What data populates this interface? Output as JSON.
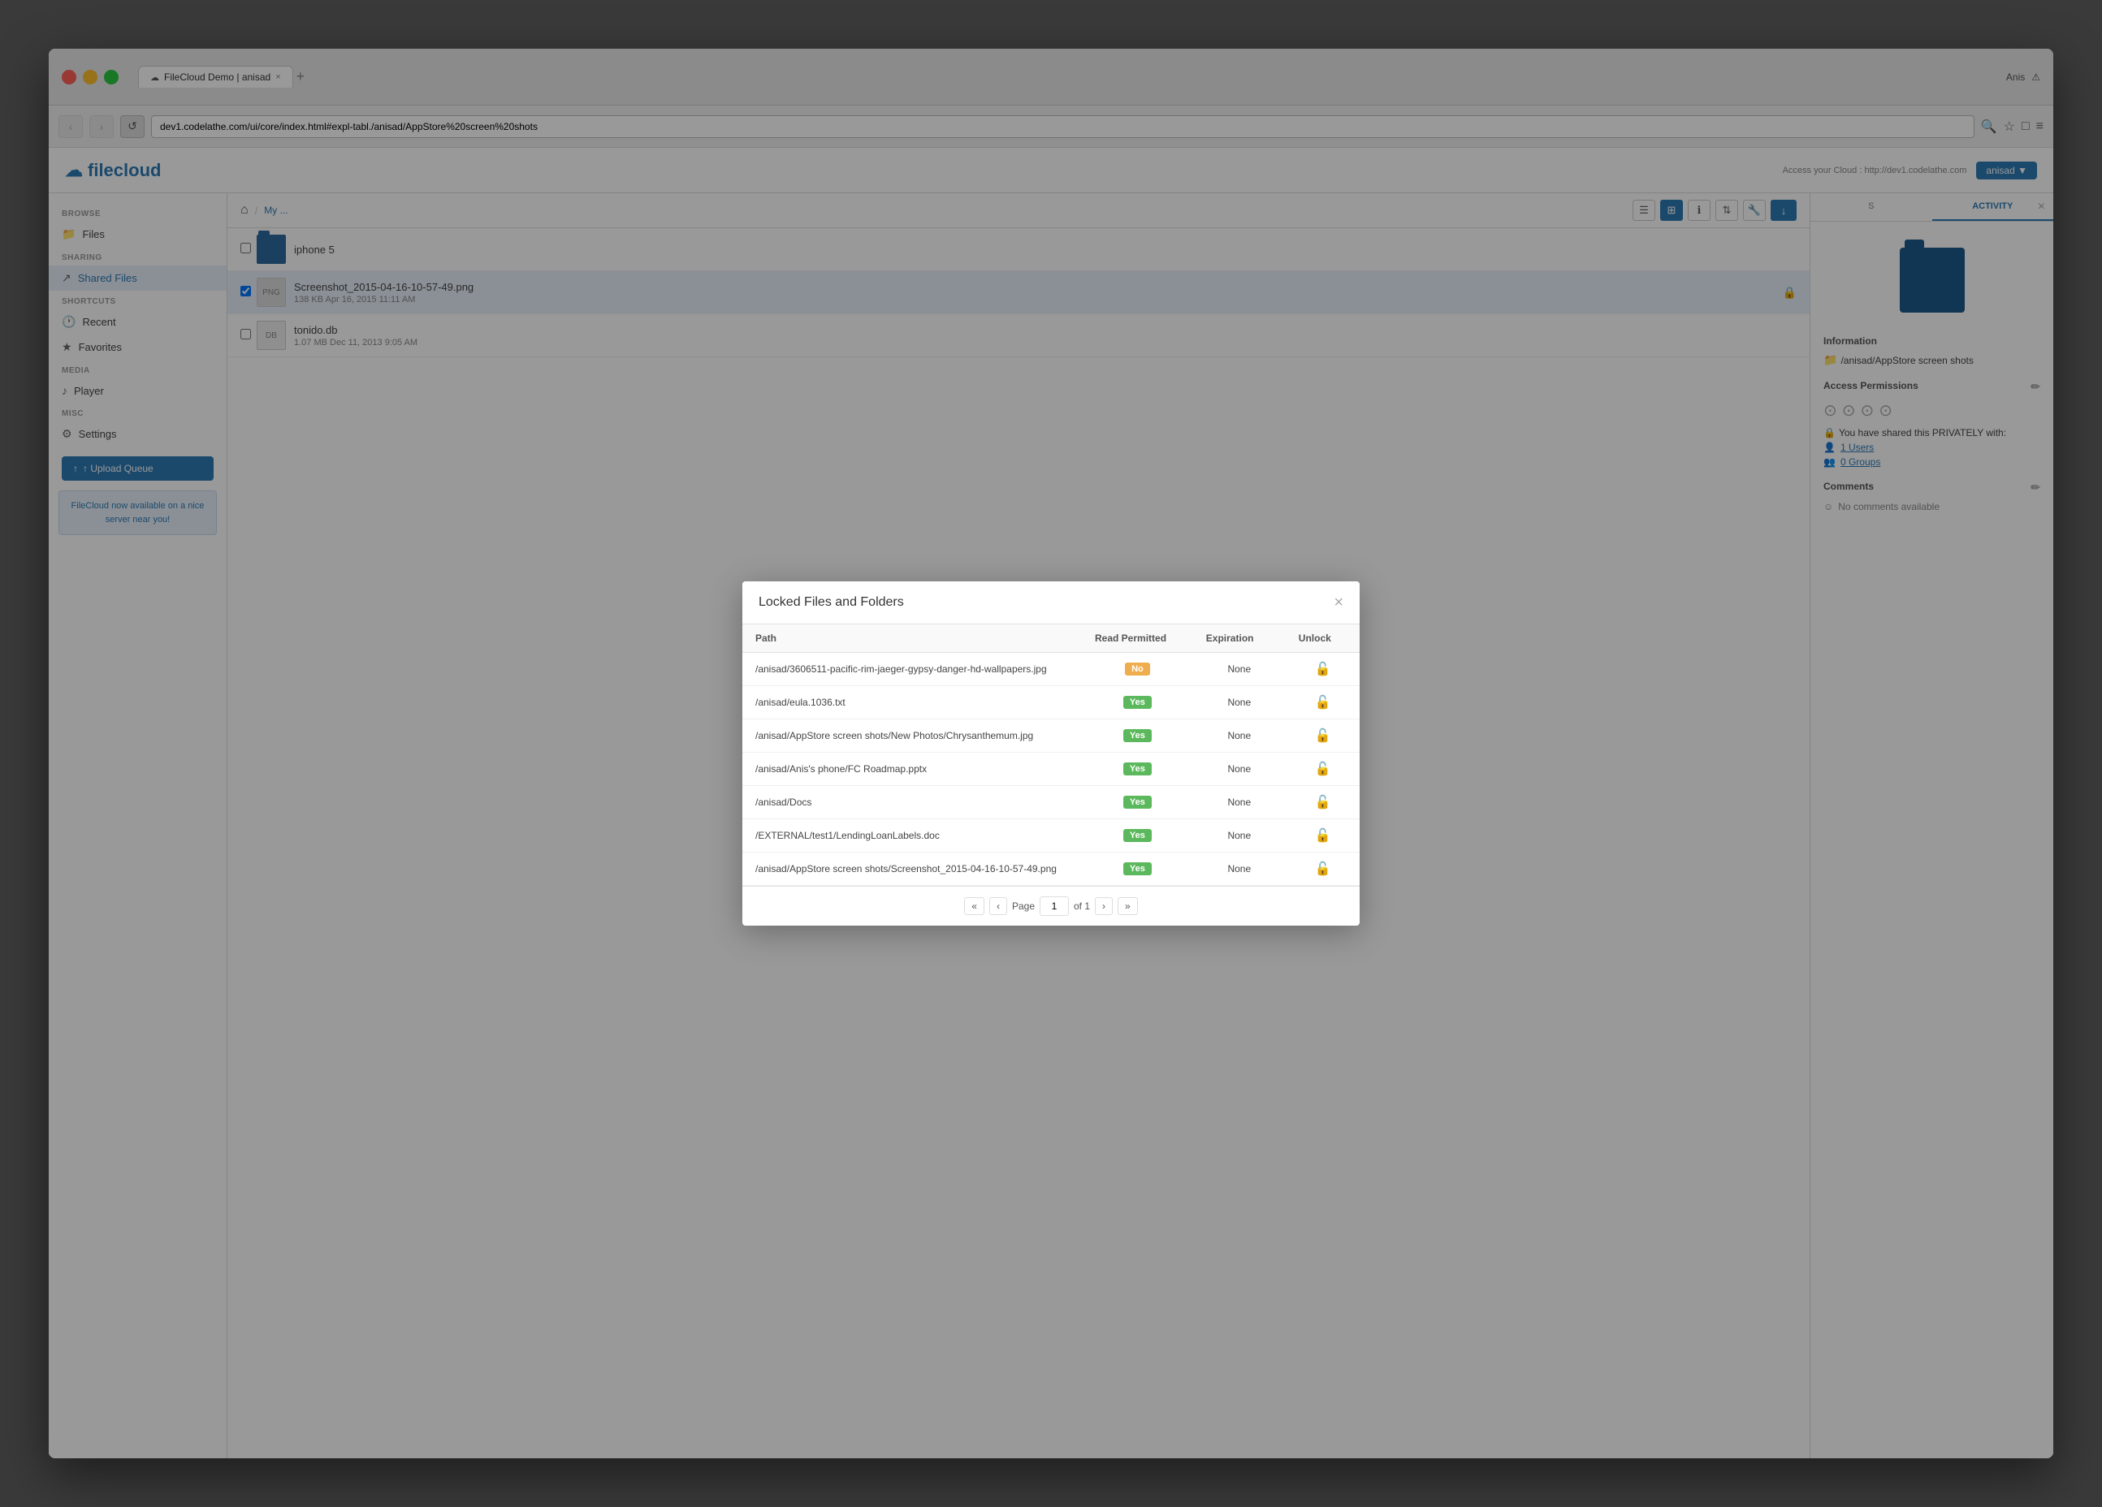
{
  "browser": {
    "tab_label": "FileCloud Demo | anisad",
    "address": "dev1.codelathe.com/ui/core/index.html#expl-tabl./anisad/AppStore%20screen%20shots",
    "new_tab_icon": "+",
    "back_btn": "‹",
    "forward_btn": "›",
    "refresh_btn": "↺",
    "window_user": "Anis",
    "window_user_alert": "⚠"
  },
  "app_header": {
    "logo_text": "filecloud",
    "logo_icon": "☁",
    "access_text": "Access your Cloud : http://dev1.codelathe.com",
    "user_label": "anisad ▼"
  },
  "sidebar": {
    "browse_label": "BROWSE",
    "files_label": "Files",
    "sharing_label": "SHARING",
    "shared_files_label": "Shared Files",
    "shortcuts_label": "SHORTCUTS",
    "recent_label": "Recent",
    "favorites_label": "Favorites",
    "media_label": "MEDIA",
    "player_label": "Player",
    "misc_label": "MISC",
    "settings_label": "Settings",
    "upload_btn": "↑ Upload Queue",
    "promo_text": "FileCloud now available on a nice server near you!"
  },
  "breadcrumb": {
    "home_icon": "⌂",
    "sep": "/",
    "path_item": "My ..."
  },
  "file_list": {
    "items": [
      {
        "type": "folder",
        "name": "iphone 5",
        "meta": "",
        "locked": false
      },
      {
        "type": "file",
        "name": "Screenshot_2015-04-16-10-57-49.png",
        "meta": "138 KB     Apr 16, 2015 11:11 AM",
        "locked": true
      },
      {
        "type": "file",
        "name": "tonido.db",
        "meta": "1.07 MB     Dec 11, 2013 9:05 AM",
        "locked": false
      }
    ]
  },
  "right_panel": {
    "tabs": [
      "S",
      "ACTIVITY"
    ],
    "folder_path": "/anisad/AppStore screen shots",
    "section_info": "Information",
    "section_access": "Access Permissions",
    "section_comments": "Comments",
    "sharing_label": "You have shared this PRIVATELY with:",
    "users_label": "1 Users",
    "groups_label": "0 Groups",
    "no_comments": "No comments available"
  },
  "modal": {
    "title": "Locked Files and Folders",
    "close_icon": "×",
    "table_headers": {
      "path": "Path",
      "read_permitted": "Read Permitted",
      "expiration": "Expiration",
      "unlock": "Unlock"
    },
    "rows": [
      {
        "path": "/anisad/3606511-pacific-rim-jaeger-gypsy-danger-hd-wallpapers.jpg",
        "read_permitted": "No",
        "read_class": "badge-no",
        "expiration": "None"
      },
      {
        "path": "/anisad/eula.1036.txt",
        "read_permitted": "Yes",
        "read_class": "badge-yes",
        "expiration": "None"
      },
      {
        "path": "/anisad/AppStore screen shots/New Photos/Chrysanthemum.jpg",
        "read_permitted": "Yes",
        "read_class": "badge-yes",
        "expiration": "None"
      },
      {
        "path": "/anisad/Anis's phone/FC Roadmap.pptx",
        "read_permitted": "Yes",
        "read_class": "badge-yes",
        "expiration": "None"
      },
      {
        "path": "/anisad/Docs",
        "read_permitted": "Yes",
        "read_class": "badge-yes",
        "expiration": "None"
      },
      {
        "path": "/EXTERNAL/test1/LendingLoanLabels.doc",
        "read_permitted": "Yes",
        "read_class": "badge-yes",
        "expiration": "None"
      },
      {
        "path": "/anisad/AppStore screen shots/Screenshot_2015-04-16-10-57-49.png",
        "read_permitted": "Yes",
        "read_class": "badge-yes",
        "expiration": "None"
      }
    ],
    "pagination": {
      "page_label": "Page",
      "current_page": "1",
      "of_label": "of 1"
    }
  }
}
